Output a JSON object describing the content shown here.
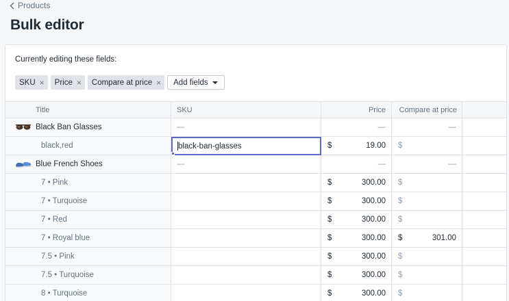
{
  "breadcrumb": {
    "label": "Products"
  },
  "page": {
    "title": "Bulk editor"
  },
  "editing": {
    "label": "Currently editing these fields:",
    "fields": [
      "SKU",
      "Price",
      "Compare at price"
    ],
    "add_fields_label": "Add fields",
    "remove_glyph": "×"
  },
  "columns": {
    "title": "Title",
    "sku": "SKU",
    "price": "Price",
    "compare": "Compare at price"
  },
  "placeholder_dash": "—",
  "currency": "$",
  "rows": [
    {
      "type": "product",
      "title": "Black Ban Glasses",
      "thumb": "glasses-thumbnail"
    },
    {
      "type": "variant",
      "title": "black,red",
      "sku": "black-ban-glasses",
      "price": "19.00",
      "compare": "",
      "active": true
    },
    {
      "type": "product",
      "title": "Blue French Shoes",
      "thumb": "shoes-thumbnail"
    },
    {
      "type": "variant",
      "title": "7 • Pink",
      "sku": "",
      "price": "300.00",
      "compare": ""
    },
    {
      "type": "variant",
      "title": "7 • Turquoise",
      "sku": "",
      "price": "300.00",
      "compare": ""
    },
    {
      "type": "variant",
      "title": "7 • Red",
      "sku": "",
      "price": "300.00",
      "compare": ""
    },
    {
      "type": "variant",
      "title": "7 • Royal blue",
      "sku": "",
      "price": "300.00",
      "compare": "301.00"
    },
    {
      "type": "variant",
      "title": "7.5 • Pink",
      "sku": "",
      "price": "300.00",
      "compare": ""
    },
    {
      "type": "variant",
      "title": "7.5 • Turquoise",
      "sku": "",
      "price": "300.00",
      "compare": ""
    },
    {
      "type": "variant",
      "title": "8 • Turquoise",
      "sku": "",
      "price": "300.00",
      "compare": ""
    }
  ],
  "colors": {
    "accent": "#5c6ac4",
    "border": "#dfe3e8",
    "muted": "#637381"
  }
}
